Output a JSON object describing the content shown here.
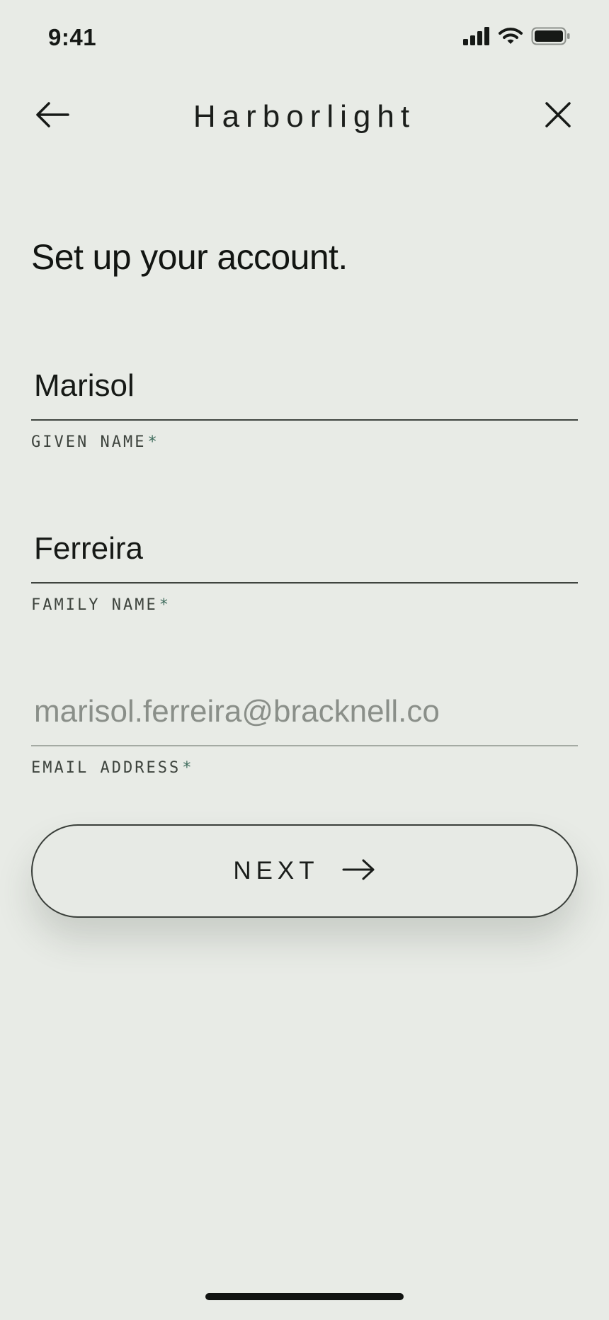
{
  "status_bar": {
    "time": "9:41",
    "icons": [
      "cellular-signal-icon",
      "wifi-icon",
      "battery-icon"
    ]
  },
  "nav": {
    "title": "Harborlight",
    "back_icon": "arrow-left-icon",
    "close_icon": "close-icon"
  },
  "page": {
    "title": "Set up your account."
  },
  "form": {
    "given_name": {
      "value": "Marisol",
      "label": "GIVEN NAME",
      "required_mark": "*"
    },
    "family_name": {
      "value": "Ferreira",
      "label": "FAMILY NAME",
      "required_mark": "*"
    },
    "email": {
      "value": "",
      "placeholder": "marisol.ferreira@bracknell.co",
      "label": "EMAIL ADDRESS",
      "required_mark": "*"
    }
  },
  "next_button": {
    "label": "NEXT",
    "icon": "arrow-right-icon"
  },
  "colors": {
    "background": "#e8ebe6",
    "text": "#161916",
    "required_accent": "#3e6b5c",
    "placeholder": "#8a8f89"
  }
}
